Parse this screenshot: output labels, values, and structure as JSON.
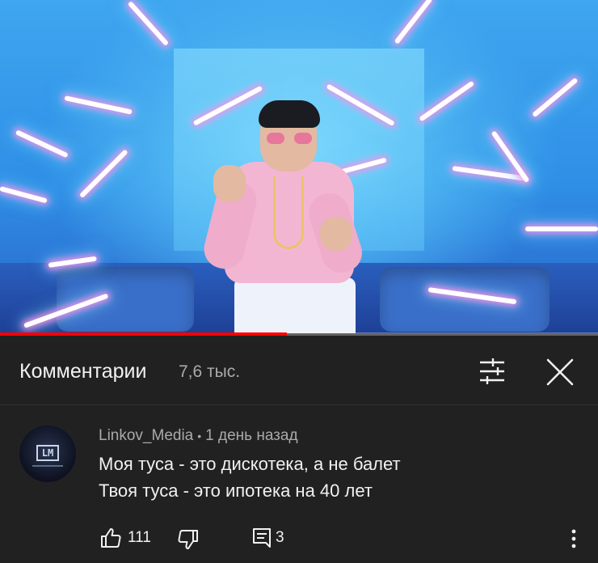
{
  "video": {
    "progress_fraction": 0.48,
    "progress_color": "#ff0000"
  },
  "comments_panel": {
    "title": "Комментарии",
    "count": "7,6 тыс.",
    "sort_icon": "sort-filter-icon",
    "close_icon": "close-icon"
  },
  "comment": {
    "author": "Linkov_Media",
    "separator": "•",
    "time": "1 день назад",
    "lines": [
      "Моя туса - это дискотека, а не балет",
      "Твоя туса - это ипотека на 40 лет"
    ],
    "avatar_text": "LM",
    "likes": "111",
    "replies": "3",
    "icons": {
      "like": "thumb-up-icon",
      "dislike": "thumb-down-icon",
      "reply": "reply-icon",
      "more": "more-vert-icon"
    }
  },
  "colors": {
    "background": "#212121",
    "primary_text": "#f1f1f1",
    "secondary_text": "#aaaaaa"
  }
}
